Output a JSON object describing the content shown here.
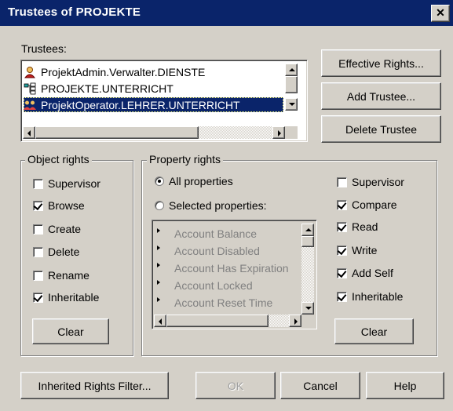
{
  "window": {
    "title": "Trustees of PROJEKTE",
    "close_glyph": "✕"
  },
  "trustees": {
    "label": "Trustees:",
    "items": [
      {
        "name": "ProjektAdmin.Verwalter.DIENSTE",
        "icon": "user-icon",
        "selected": false
      },
      {
        "name": "PROJEKTE.UNTERRICHT",
        "icon": "organizational-unit-icon",
        "selected": false
      },
      {
        "name": "ProjektOperator.LEHRER.UNTERRICHT",
        "icon": "group-icon",
        "selected": true
      }
    ]
  },
  "buttons": {
    "effective_rights": "Effective Rights...",
    "add_trustee": "Add Trustee...",
    "delete_trustee": "Delete Trustee",
    "object_clear": "Clear",
    "property_clear": "Clear",
    "inherited_rights_filter": "Inherited Rights Filter...",
    "ok": "OK",
    "cancel": "Cancel",
    "help": "Help"
  },
  "object_rights": {
    "label": "Object rights",
    "items": [
      {
        "label": "Supervisor",
        "checked": false
      },
      {
        "label": "Browse",
        "checked": true
      },
      {
        "label": "Create",
        "checked": false
      },
      {
        "label": "Delete",
        "checked": false
      },
      {
        "label": "Rename",
        "checked": false
      },
      {
        "label": "Inheritable",
        "checked": true
      }
    ]
  },
  "property_rights": {
    "label": "Property rights",
    "all_properties": "All properties",
    "selected_properties": "Selected properties:",
    "mode": "all",
    "properties": [
      "Account Balance",
      "Account Disabled",
      "Account Has Expiration",
      "Account Locked",
      "Account Reset Time"
    ],
    "items": [
      {
        "label": "Supervisor",
        "checked": false
      },
      {
        "label": "Compare",
        "checked": true
      },
      {
        "label": "Read",
        "checked": true
      },
      {
        "label": "Write",
        "checked": true
      },
      {
        "label": "Add Self",
        "checked": true
      },
      {
        "label": "Inheritable",
        "checked": true
      }
    ]
  }
}
